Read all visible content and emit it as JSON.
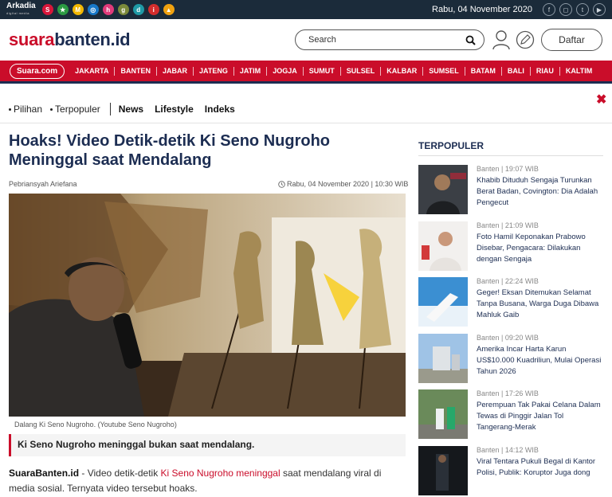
{
  "topbar": {
    "network_name": "Arkadia",
    "network_sub": "digital media",
    "network_icons": [
      {
        "name": "suara-network-icon",
        "glyph": "S",
        "color": "#d8163a"
      },
      {
        "name": "star-network-icon",
        "glyph": "★",
        "color": "#2b9a42"
      },
      {
        "name": "matamata-network-icon",
        "glyph": "M",
        "color": "#f2b800"
      },
      {
        "name": "globe-network-icon",
        "glyph": "◎",
        "color": "#1778c8"
      },
      {
        "name": "hits-network-icon",
        "glyph": "h",
        "color": "#e03a7a"
      },
      {
        "name": "gadget-network-icon",
        "glyph": "g",
        "color": "#7b8a3b"
      },
      {
        "name": "dewiku-network-icon",
        "glyph": "d",
        "color": "#1f9aa6"
      },
      {
        "name": "info-network-icon",
        "glyph": "i",
        "color": "#d22d2d"
      },
      {
        "name": "triangle-network-icon",
        "glyph": "▲",
        "color": "#f0a210"
      }
    ],
    "date": "Rabu, 04 November 2020",
    "social_icons": [
      "facebook-icon",
      "instagram-icon",
      "twitter-icon",
      "youtube-icon"
    ]
  },
  "header": {
    "logo_red": "suara",
    "logo_dark": "banten.id",
    "search_placeholder": "Search",
    "register_label": "Daftar"
  },
  "navbar": {
    "home_label": "Suara.com",
    "items": [
      "JAKARTA",
      "BANTEN",
      "JABAR",
      "JATENG",
      "JATIM",
      "JOGJA",
      "SUMUT",
      "SULSEL",
      "KALBAR",
      "SUMSEL",
      "BATAM",
      "BALI",
      "RIAU",
      "KALTIM"
    ]
  },
  "subnav": {
    "bullets": [
      "Pilihan",
      "Terpopuler"
    ],
    "links": [
      "News",
      "Lifestyle",
      "Indeks"
    ],
    "close_glyph": "✖"
  },
  "article": {
    "title": "Hoaks! Video Detik-detik Ki Seno Nugroho Meninggal saat Mendalang",
    "author": "Pebriansyah Ariefana",
    "published": "Rabu, 04 November 2020 | 10:30 WIB",
    "image_caption": "Dalang Ki Seno Nugroho. (Youtube Seno Nugroho)",
    "lead": "Ki Seno Nugroho meninggal bukan saat mendalang.",
    "body_site": "SuaraBanten.id",
    "body_part1": " - Video detik-detik ",
    "body_link": "Ki Seno Nugroho meninggal",
    "body_part2": " saat mendalang viral di media sosial. Ternyata video tersebut hoaks."
  },
  "colors": {
    "brand_red": "#ca0d2a",
    "brand_navy": "#1c2d52"
  },
  "sidebar": {
    "title": "TERPOPULER",
    "items": [
      {
        "meta": "Banten | 19:07 WIB",
        "headline": "Khabib Dituduh Sengaja Turunkan Berat Badan, Covington: Dia Adalah Pengecut"
      },
      {
        "meta": "Banten | 21:09 WIB",
        "headline": "Foto Hamil Keponakan Prabowo Disebar, Pengacara: Dilakukan dengan Sengaja"
      },
      {
        "meta": "Banten | 22:24 WIB",
        "headline": "Geger! Eksan Ditemukan Selamat Tanpa Busana, Warga Duga Dibawa Mahluk Gaib"
      },
      {
        "meta": "Banten | 09:20 WIB",
        "headline": "Amerika Incar Harta Karun US$10.000 Kuadriliun, Mulai Operasi Tahun 2026"
      },
      {
        "meta": "Banten | 17:26 WIB",
        "headline": "Perempuan Tak Pakai Celana Dalam Tewas di Pinggir Jalan Tol Tangerang-Merak"
      },
      {
        "meta": "Banten | 14:12 WIB",
        "headline": "Viral Tentara Pukuli Begal di Kantor Polisi, Publik: Koruptor Juga dong"
      }
    ]
  }
}
